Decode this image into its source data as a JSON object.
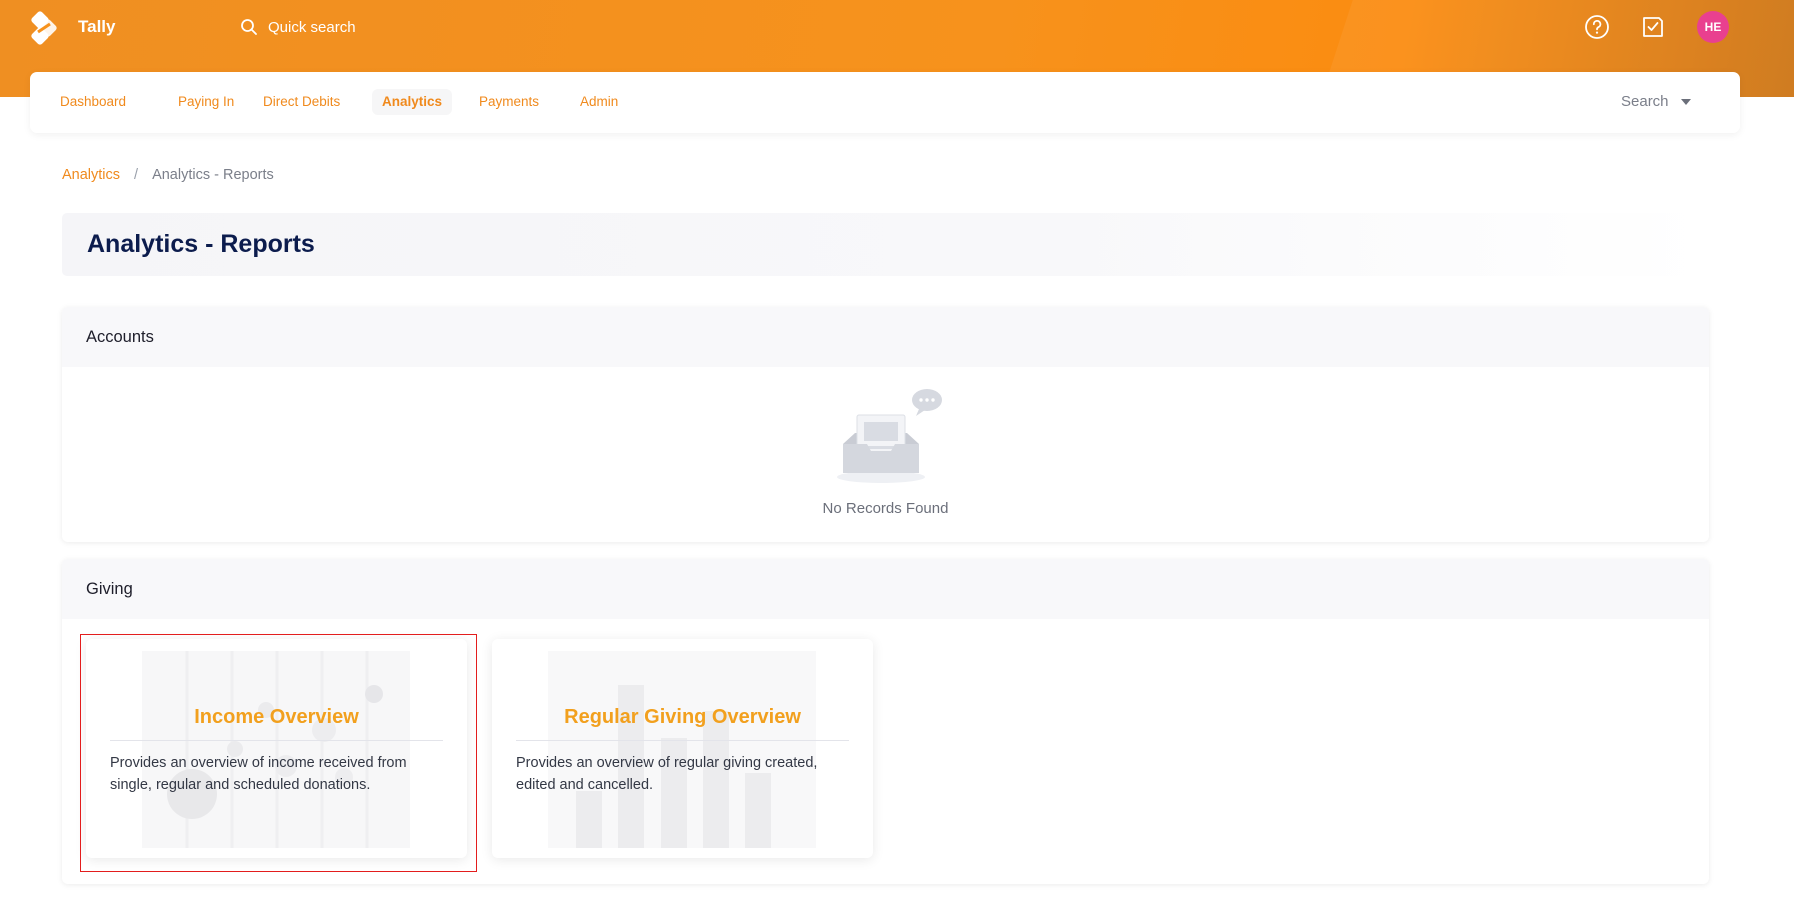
{
  "topbar": {
    "brand": "Tally",
    "quick_search_placeholder": "Quick search",
    "help_icon": "help-icon",
    "tasks_icon": "task-check-icon",
    "avatar_initials": "HE",
    "colors": {
      "bar": "#f7921c",
      "avatar": "#e9408f"
    }
  },
  "nav": {
    "items": [
      {
        "label": "Dashboard"
      },
      {
        "label": "Paying In"
      },
      {
        "label": "Direct Debits"
      },
      {
        "label": "Analytics",
        "active": true
      },
      {
        "label": "Payments"
      },
      {
        "label": "Admin"
      }
    ],
    "search_label": "Search",
    "accent": "#f08a1d"
  },
  "breadcrumb": {
    "root": "Analytics",
    "separator": "/",
    "current": "Analytics - Reports"
  },
  "page": {
    "title": "Analytics - Reports",
    "title_color": "#0c1c4d"
  },
  "accounts": {
    "heading": "Accounts",
    "empty_text": "No Records Found",
    "empty_icon": "empty-inbox-icon"
  },
  "giving": {
    "heading": "Giving",
    "reports": [
      {
        "title": "Income Overview",
        "description": "Provides an overview of income received from single, regular and scheduled donations."
      },
      {
        "title": "Regular Giving Overview",
        "description": "Provides an overview of regular giving created, edited and cancelled."
      }
    ],
    "title_color": "#f2a01e"
  }
}
